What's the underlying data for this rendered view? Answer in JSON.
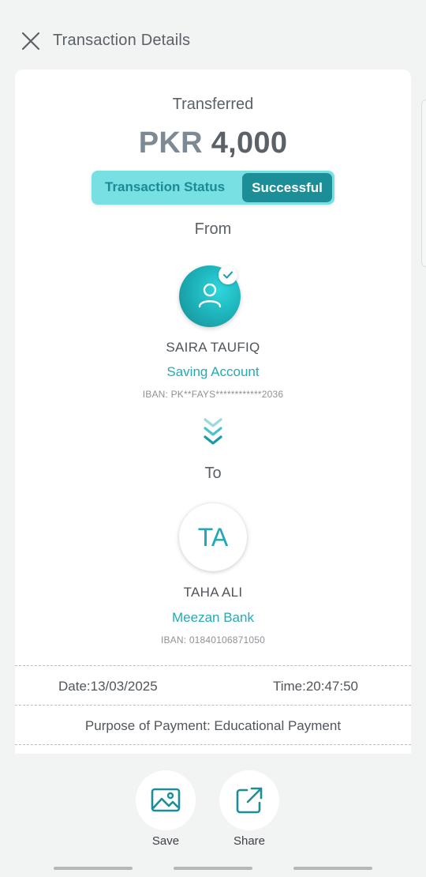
{
  "header": {
    "title": "Transaction Details",
    "close_icon": "close-icon"
  },
  "transaction": {
    "type_label": "Transferred",
    "currency": "PKR",
    "amount": "4,000",
    "status_label": "Transaction Status",
    "status_value": "Successful"
  },
  "from": {
    "label": "From",
    "name": "SAIRA TAUFIQ",
    "account": "Saving Account",
    "iban": "IBAN: PK**FAYS************2036"
  },
  "to": {
    "label": "To",
    "initials": "TA",
    "name": "TAHA ALI",
    "bank": "Meezan Bank",
    "iban": "IBAN: 01840106871050"
  },
  "details": {
    "date": "Date:13/03/2025",
    "time": "Time:20:47:50",
    "purpose": "Purpose of Payment: Educational Payment"
  },
  "actions": {
    "save_label": "Save",
    "share_label": "Share"
  },
  "colors": {
    "accent": "#24aab3",
    "accent_dark": "#1c8e98",
    "status_bg": "#78dfe3"
  }
}
